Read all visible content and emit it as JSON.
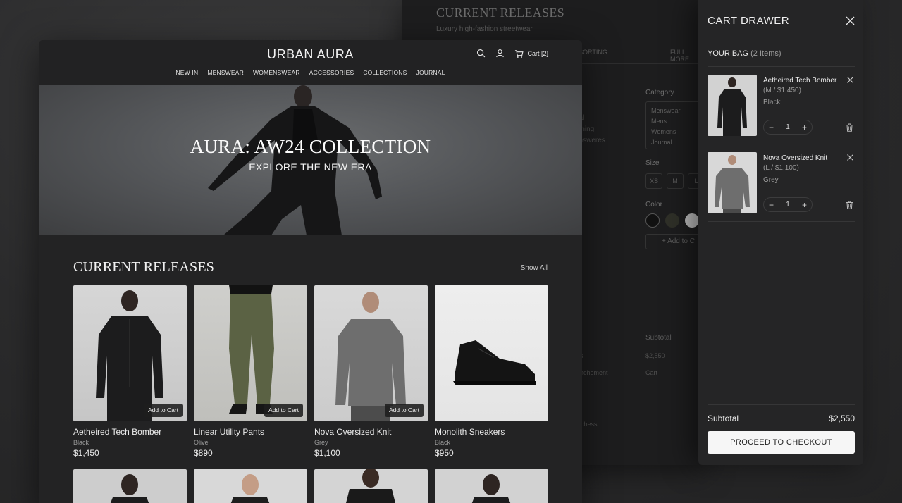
{
  "background_panel": {
    "title": "CURRENT RELEASES",
    "subtitle": "Luxury high-fashion streetwear",
    "sort_label": "SORTING",
    "view_label": "FULL MORE",
    "category_label": "Category",
    "category_options": [
      "Menswear",
      "Mens",
      "Womens",
      "Journal"
    ],
    "left_items": [
      "nal",
      "othing",
      "answeres"
    ],
    "size_label": "Size",
    "sizes": [
      "XS",
      "M",
      "L"
    ],
    "color_label": "Color",
    "swatches": [
      "#111111",
      "#2f3028",
      "#bdbdbd"
    ],
    "add_label": "+ Add to C",
    "subtotal_label": "Subtotal",
    "subtotal_value": "$2,550",
    "cart_label": "Cart",
    "frag_1": "g",
    "frag_2": "s",
    "frag_3": "nchement",
    "frag_4": "archess"
  },
  "header": {
    "brand": "URBAN AURA",
    "cart_label": "Cart [2]",
    "nav": [
      "NEW IN",
      "MENSWEAR",
      "WOMENSWEAR",
      "ACCESSORIES",
      "COLLECTIONS",
      "JOURNAL"
    ]
  },
  "hero": {
    "title": "AURA: AW24 COLLECTION",
    "subtitle": "EXPLORE THE NEW ERA"
  },
  "releases": {
    "title": "CURRENT RELEASES",
    "show_all": "Show All",
    "add_to_cart": "Add to Cart",
    "products": [
      {
        "name": "Aetheired Tech Bomber",
        "color": "Black",
        "price": "$1,450"
      },
      {
        "name": "Linear Utility Pants",
        "color": "Olive",
        "price": "$890"
      },
      {
        "name": "Nova Oversized Knit",
        "color": "Grey",
        "price": "$1,100"
      },
      {
        "name": "Monolith Sneakers",
        "color": "Black",
        "price": "$950"
      }
    ]
  },
  "cart": {
    "title": "CART DRAWER",
    "bag_label": "YOUR BAG",
    "bag_count": "(2 Items)",
    "items": [
      {
        "name": "Aetheired Tech Bomber",
        "meta": "(M / $1,450)",
        "color": "Black",
        "qty": "1"
      },
      {
        "name": "Nova Oversized Knit",
        "meta": "(L / $1,100)",
        "color": "Grey",
        "qty": "1"
      }
    ],
    "subtotal_label": "Subtotal",
    "subtotal_value": "$2,550",
    "checkout_label": "PROCEED TO CHECKOUT"
  }
}
